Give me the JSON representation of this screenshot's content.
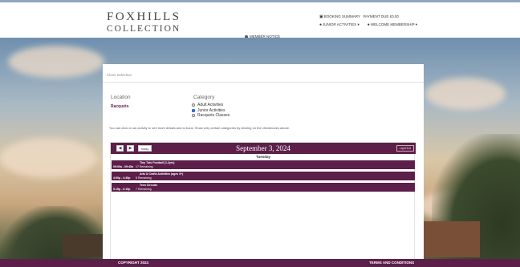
{
  "header": {
    "logo_line1": "FOXHILLS",
    "logo_line2": "COLLECTION",
    "booking_summary": "BOOKING SUMMARY",
    "payment_due": "PAYMENT DUE £0.00",
    "junior_activities": "JUNIOR ACTIVITIES ▾",
    "welcome": "WELCOME MEMBERSHIP ▾",
    "member_notice": "MEMBER NOTICE"
  },
  "panel": {
    "title": "Class Selection",
    "location_label": "Location",
    "location_value": "Racquets",
    "category_label": "Category",
    "categories": [
      {
        "label": "Adult Activities",
        "checked": false
      },
      {
        "label": "Junior Activities",
        "checked": true
      },
      {
        "label": "Racquets Classes",
        "checked": false
      }
    ],
    "hint": "You can click on an activity to see more details and to book. Show only certain categories by clicking on the checkboxes above."
  },
  "calendar": {
    "prev_label": "◀",
    "next_label": "▶",
    "today_label": "today",
    "date_title": "September 3, 2024",
    "light_label": "Light Ent",
    "day_label": "Tuesday",
    "events": [
      {
        "title": "Tiny Tots Football (1-3yrs)",
        "time": "09:00a - 09:45a",
        "remaining": "17 Remaining"
      },
      {
        "title": "Arts & Crafts Activities (ages 3+)",
        "time": "4:00p - 4:45p",
        "remaining": "5 Remaining"
      },
      {
        "title": "Teen Circuits",
        "time": "5:15p - 6:15p",
        "remaining": "7 Remaining"
      }
    ]
  },
  "footer": {
    "copyright": "COPYRIGHT 2024",
    "terms": "TERMS AND CONDITIONS"
  },
  "colors": {
    "brand": "#5c1f4a",
    "checkbox_on": "#2f6fcf"
  }
}
